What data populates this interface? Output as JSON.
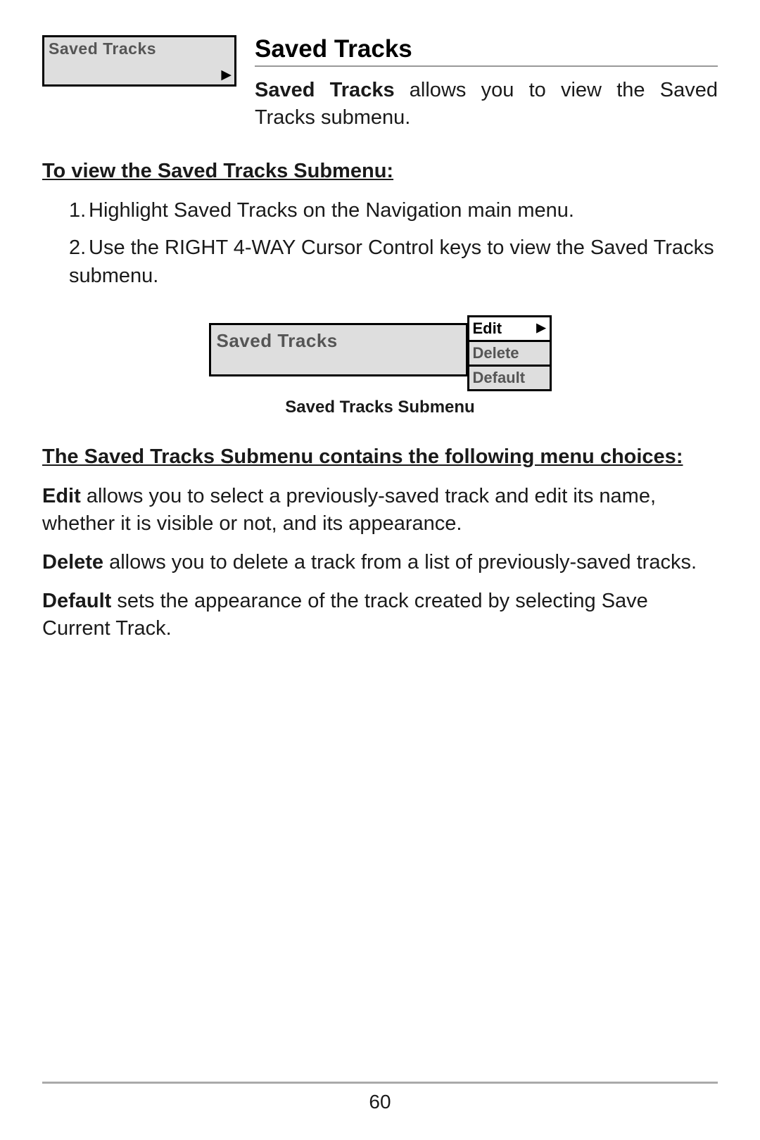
{
  "menu_box": {
    "label": "Saved Tracks"
  },
  "section": {
    "heading": "Saved Tracks",
    "intro_bold": "Saved Tracks",
    "intro_rest": " allows you to view the Saved Tracks submenu."
  },
  "howto": {
    "title": "To view the Saved Tracks Submenu:",
    "steps": [
      "Highlight Saved Tracks on the Navigation main menu.",
      "Use the RIGHT 4-WAY Cursor Control keys to view the Saved Tracks submenu."
    ]
  },
  "submenu_figure": {
    "left_label": "Saved Tracks",
    "options": [
      {
        "label": "Edit",
        "selected": true
      },
      {
        "label": "Delete",
        "selected": false
      },
      {
        "label": "Default",
        "selected": false
      }
    ],
    "caption": "Saved Tracks Submenu"
  },
  "choices_section": {
    "title": "The Saved Tracks Submenu contains the following menu choices:",
    "items": [
      {
        "bold": "Edit",
        "rest": " allows you to select a previously-saved track and edit its name, whether it is visible or not, and its appearance."
      },
      {
        "bold": "Delete",
        "rest": " allows you to delete a track from a list of previously-saved tracks."
      },
      {
        "bold": "Default",
        "rest": " sets the appearance of the track created by selecting Save Current Track."
      }
    ]
  },
  "page_number": "60"
}
